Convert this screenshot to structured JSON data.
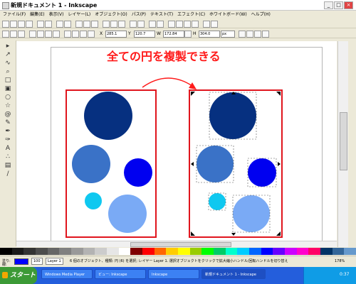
{
  "window": {
    "title": "新規ドキュメント 1 - Inkscape",
    "minimize": "_",
    "maximize": "□",
    "close": "×"
  },
  "menu": [
    "ファイル(F)",
    "編集(E)",
    "表示(V)",
    "レイヤー(L)",
    "オブジェクト(O)",
    "パス(P)",
    "テキスト(T)",
    "エフェクト(C)",
    "ホワイトボード(W)",
    "ヘルプ(H)"
  ],
  "toolbar": {
    "x_label": "X",
    "x_value": "285.1",
    "y_label": "Y",
    "y_value": "120.7",
    "w_label": "W",
    "w_value": "172.84",
    "h_label": "H",
    "h_value": "304.0",
    "unit_value": "px"
  },
  "annotation": {
    "caption": "全ての円を複製できる",
    "arrow_color": "#ff1a1a"
  },
  "status": {
    "fill_label": "塗り:",
    "stroke_label": "線:",
    "fill_color": "#0000ff",
    "stroke_color": "#ffffff",
    "opacity": "100",
    "layer": "Layer 1",
    "message": "6 個のオブジェクト、種類: 円 (6) を選択; レイヤー Layer 1. 選択オブジェクトをクリックで拡大縮小ハンドル/回転ハンドルを切り替え",
    "zoom": "178%"
  },
  "taskbar": {
    "start": "スタート",
    "tasks": [
      "Windows Media Player",
      "ビュー: Inkscape",
      "Inkscape",
      "新規ドキュメント 1 - Inkscape"
    ],
    "clock": "0:37"
  },
  "colors": {
    "dark_navy": "#063080",
    "medium_blue": "#3a72c7",
    "pure_blue": "#0000f0",
    "cyan": "#0fc8f0",
    "light_blue": "#7aaaf5",
    "frame_red": "#e0151d"
  },
  "palette": [
    "#000000",
    "#1a1a1a",
    "#333333",
    "#4d4d4d",
    "#666666",
    "#808080",
    "#999999",
    "#b3b3b3",
    "#cccccc",
    "#e6e6e6",
    "#ffffff",
    "#7f0000",
    "#ff0000",
    "#ff6600",
    "#ffcc00",
    "#ffff00",
    "#99cc00",
    "#00ff00",
    "#00cc66",
    "#00ffcc",
    "#00ccff",
    "#0066ff",
    "#0000ff",
    "#6600ff",
    "#cc00ff",
    "#ff00cc",
    "#ff0066",
    "#003366",
    "#336699",
    "#6699cc"
  ]
}
